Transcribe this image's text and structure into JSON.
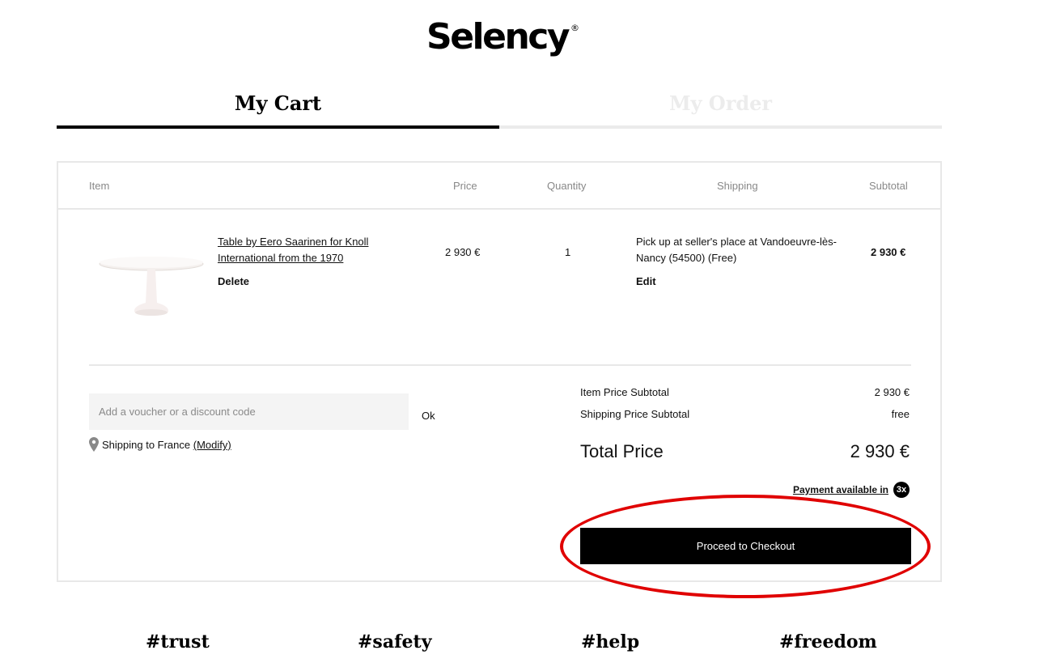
{
  "brand": {
    "name": "Selency",
    "registered_mark": "®"
  },
  "tabs": [
    {
      "label": "My Cart",
      "active": true
    },
    {
      "label": "My Order",
      "active": false
    }
  ],
  "table": {
    "headers": {
      "item": "Item",
      "price": "Price",
      "quantity": "Quantity",
      "shipping": "Shipping",
      "subtotal": "Subtotal"
    }
  },
  "product": {
    "title": "Table by Eero Saarinen for Knoll International from the 1970",
    "delete_label": "Delete",
    "price": "2 930 €",
    "quantity": "1",
    "shipping": "Pick up at seller's place at Vandoeuvre-lès-Nancy (54500) (Free)",
    "edit_label": "Edit",
    "subtotal": "2 930 €"
  },
  "voucher": {
    "placeholder": "Add a voucher or a discount code",
    "ok_label": "Ok"
  },
  "shipping_country": {
    "text": "Shipping to France",
    "modify_label": "(Modify)"
  },
  "summary": {
    "item_label": "Item Price Subtotal",
    "item_value": "2 930 €",
    "shipping_label": "Shipping Price Subtotal",
    "shipping_value": "free",
    "total_label": "Total Price",
    "total_value": "2 930 €",
    "payment_label": "Payment available in",
    "payment_badge": "3x"
  },
  "checkout_label": "Proceed to Checkout",
  "annotation": {
    "color": "#e00000"
  },
  "footer_tags": [
    "#trust",
    "#safety",
    "#help",
    "#freedom"
  ]
}
